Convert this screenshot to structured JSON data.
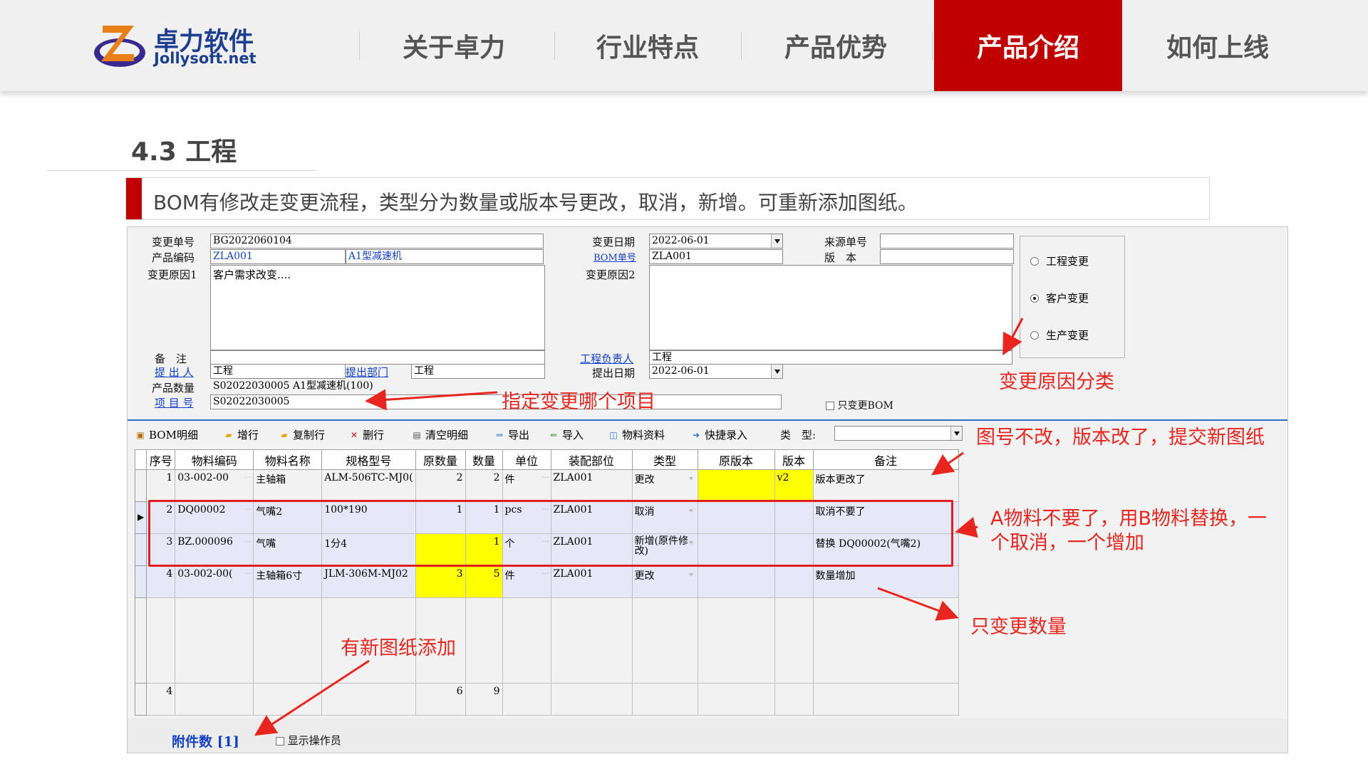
{
  "logo": {
    "cn": "卓力软件",
    "en": "Jollysoft.net"
  },
  "nav": {
    "items": [
      "关于卓力",
      "行业特点",
      "产品优势",
      "产品介绍",
      "如何上线"
    ],
    "active": "产品介绍"
  },
  "section_title": "4.3 工程",
  "description": "BOM有修改走变更流程，类型分为数量或版本号更改，取消，新增。可重新添加图纸。",
  "form": {
    "change_no_label": "变更单号",
    "change_no": "BG2022060104",
    "product_code_label": "产品编码",
    "product_code": "ZLA001",
    "product_name": "A1型减速机",
    "reason1_label": "变更原因1",
    "reason1": "客户需求改变....",
    "remark_label": "备　注",
    "proposer_label": "提 出 人",
    "proposer": "工程",
    "dept_label": "提出部门",
    "dept": "工程",
    "product_qty_label": "产品数量",
    "product_qty": "S02022030005 A1型减速机(100)",
    "project_no_label": "项 目 号",
    "project_no": "S02022030005",
    "change_date_label": "变更日期",
    "change_date": "2022-06-01",
    "bom_no_label": "BOM单号",
    "bom_no": "ZLA001",
    "reason2_label": "变更原因2",
    "reason2": "",
    "eng_owner_label": "工程负责人",
    "eng_owner": "工程",
    "submit_date_label": "提出日期",
    "submit_date": "2022-06-01",
    "source_no_label": "来源单号",
    "source_no": "",
    "version_label": "版　本",
    "version": "",
    "radio": [
      {
        "label": "工程变更",
        "checked": false
      },
      {
        "label": "客户变更",
        "checked": true
      },
      {
        "label": "生产变更",
        "checked": false
      }
    ],
    "only_bom_label": "只变更BOM"
  },
  "toolbar": {
    "items": [
      {
        "label": "BOM明细",
        "icon": "bom-icon"
      },
      {
        "label": "增行",
        "icon": "add-row-icon"
      },
      {
        "label": "复制行",
        "icon": "copy-row-icon"
      },
      {
        "label": "删行",
        "icon": "delete-row-icon"
      },
      {
        "label": "清空明细",
        "icon": "clear-icon"
      },
      {
        "label": "导出",
        "icon": "export-icon"
      },
      {
        "label": "导入",
        "icon": "import-icon"
      },
      {
        "label": "物料资料",
        "icon": "material-icon"
      },
      {
        "label": "快捷录入",
        "icon": "quick-entry-icon"
      }
    ],
    "type_label": "类　型:",
    "type_value": ""
  },
  "grid": {
    "columns": [
      "序号",
      "物料编码",
      "物料名称",
      "规格型号",
      "原数量",
      "数量",
      "单位",
      "装配部位",
      "类型",
      "原版本",
      "版本",
      "备注"
    ],
    "rows": [
      [
        "1",
        "03-002-00",
        "主轴箱",
        "ALM-506TC-MJ0(",
        "2",
        "2",
        "件",
        "ZLA001",
        "更改",
        "",
        "v2",
        "版本更改了"
      ],
      [
        "2",
        "DQ00002",
        "气嘴2",
        "100*190",
        "1",
        "1",
        "pcs",
        "ZLA001",
        "取消",
        "",
        "",
        "取消不要了"
      ],
      [
        "3",
        "BZ.000096",
        "气嘴",
        "1分4",
        "",
        "1",
        "个",
        "ZLA001",
        "新增(原件修改)",
        "",
        "",
        "替换 DQ00002(气嘴2)"
      ],
      [
        "4",
        "03-002-00(",
        "主轴箱6寸",
        "JLM-306M-MJ02",
        "3",
        "5",
        "件",
        "ZLA001",
        "更改",
        "",
        "",
        "数量增加"
      ]
    ],
    "totals": [
      "4",
      "",
      "",
      "",
      "6",
      "9",
      "",
      "",
      "",
      "",
      "",
      ""
    ]
  },
  "attach": {
    "label": "附件数 [1]",
    "show_operator": "显示操作员"
  },
  "annotations": {
    "reason_class": "变更原因分类",
    "project": "指定变更哪个项目",
    "drawing_ver": "图号不改，版本改了，提交新图纸",
    "replace": "A物料不要了，用B物料替换，一个取消，一个增加",
    "qty_only": "只变更数量",
    "new_drawing": "有新图纸添加"
  },
  "colors": {
    "accent": "#c00000",
    "highlight": "#ffff00",
    "annotation": "#e8251f",
    "link": "#1340c8"
  }
}
